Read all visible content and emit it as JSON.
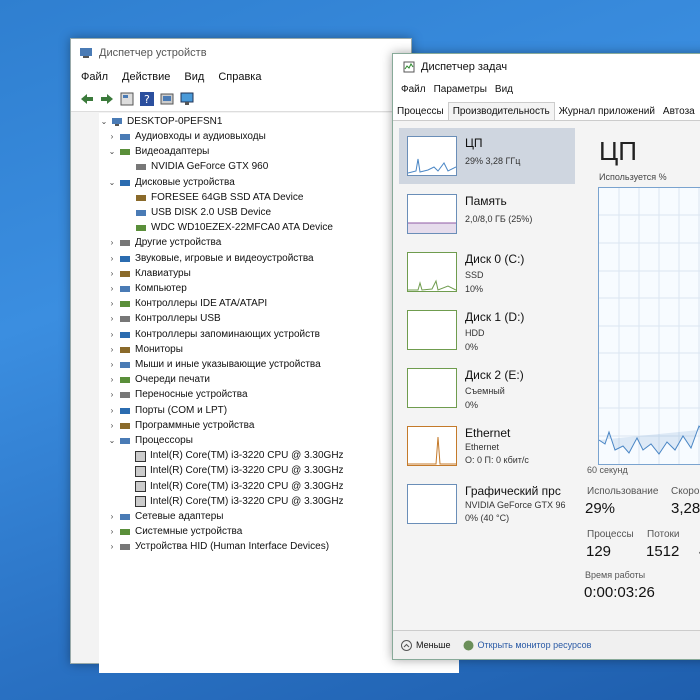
{
  "device_manager": {
    "title": "Диспетчер устройств",
    "menu": [
      "Файл",
      "Действие",
      "Вид",
      "Справка"
    ],
    "root": "DESKTOP-0PEFSN1",
    "tree": [
      {
        "label": "Аудиовходы и аудиовыходы",
        "level": 1,
        "expanded": false
      },
      {
        "label": "Видеоадаптеры",
        "level": 1,
        "expanded": true
      },
      {
        "label": "NVIDIA GeForce GTX 960",
        "level": 2
      },
      {
        "label": "Дисковые устройства",
        "level": 1,
        "expanded": true
      },
      {
        "label": "FORESEE 64GB SSD ATA Device",
        "level": 2
      },
      {
        "label": "USB DISK 2.0 USB Device",
        "level": 2
      },
      {
        "label": "WDC WD10EZEX-22MFCA0 ATA Device",
        "level": 2
      },
      {
        "label": "Другие устройства",
        "level": 1,
        "expanded": false
      },
      {
        "label": "Звуковые, игровые и видеоустройства",
        "level": 1,
        "expanded": false
      },
      {
        "label": "Клавиатуры",
        "level": 1,
        "expanded": false
      },
      {
        "label": "Компьютер",
        "level": 1,
        "expanded": false
      },
      {
        "label": "Контроллеры IDE ATA/ATAPI",
        "level": 1,
        "expanded": false
      },
      {
        "label": "Контроллеры USB",
        "level": 1,
        "expanded": false
      },
      {
        "label": "Контроллеры запоминающих устройств",
        "level": 1,
        "expanded": false
      },
      {
        "label": "Мониторы",
        "level": 1,
        "expanded": false
      },
      {
        "label": "Мыши и иные указывающие устройства",
        "level": 1,
        "expanded": false
      },
      {
        "label": "Очереди печати",
        "level": 1,
        "expanded": false
      },
      {
        "label": "Переносные устройства",
        "level": 1,
        "expanded": false
      },
      {
        "label": "Порты (COM и LPT)",
        "level": 1,
        "expanded": false
      },
      {
        "label": "Программные устройства",
        "level": 1,
        "expanded": false
      },
      {
        "label": "Процессоры",
        "level": 1,
        "expanded": true
      },
      {
        "label": "Intel(R) Core(TM) i3-3220 CPU @ 3.30GHz",
        "level": 2
      },
      {
        "label": "Intel(R) Core(TM) i3-3220 CPU @ 3.30GHz",
        "level": 2
      },
      {
        "label": "Intel(R) Core(TM) i3-3220 CPU @ 3.30GHz",
        "level": 2
      },
      {
        "label": "Intel(R) Core(TM) i3-3220 CPU @ 3.30GHz",
        "level": 2
      },
      {
        "label": "Сетевые адаптеры",
        "level": 1,
        "expanded": false
      },
      {
        "label": "Системные устройства",
        "level": 1,
        "expanded": false
      },
      {
        "label": "Устройства HID (Human Interface Devices)",
        "level": 1,
        "expanded": false
      }
    ]
  },
  "task_manager": {
    "title": "Диспетчер задач",
    "menu": [
      "Файл",
      "Параметры",
      "Вид"
    ],
    "tabs": [
      "Процессы",
      "Производительность",
      "Журнал приложений",
      "Автоза"
    ],
    "active_tab": "Производительность",
    "sidebar": [
      {
        "name": "ЦП",
        "sub1": "29% 3,28 ГГц",
        "sub2": ""
      },
      {
        "name": "Память",
        "sub1": "2,0/8,0 ГБ (25%)",
        "sub2": ""
      },
      {
        "name": "Диск 0 (C:)",
        "sub1": "SSD",
        "sub2": "10%"
      },
      {
        "name": "Диск 1 (D:)",
        "sub1": "HDD",
        "sub2": "0%"
      },
      {
        "name": "Диск 2 (E:)",
        "sub1": "Съемный",
        "sub2": "0%"
      },
      {
        "name": "Ethernet",
        "sub1": "Ethernet",
        "sub2": "О: 0 П: 0 кбит/с"
      },
      {
        "name": "Графический прс",
        "sub1": "NVIDIA GeForce GTX 96",
        "sub2": "0% (40 °C)"
      }
    ],
    "detail": {
      "heading": "ЦП",
      "usage_caption": "Используется %",
      "time_caption": "60 секунд",
      "usage_label": "Использование",
      "usage_value": "29%",
      "speed_label": "Скоро",
      "speed_value": "3,28",
      "processes_label": "Процессы",
      "processes_value": "129",
      "threads_label": "Потоки",
      "threads_value": "1512",
      "handles_value": "4",
      "uptime_label": "Время работы",
      "uptime_value": "0:00:03:26"
    },
    "footer": {
      "less": "Меньше",
      "monitor": "Открыть монитор ресурсов"
    }
  },
  "colors": {
    "cpu": "#4a86c5",
    "memory": "#8f5aa5",
    "disk": "#6f9c4e",
    "ethernet": "#c47a2a",
    "gpu": "#2c73b8"
  }
}
